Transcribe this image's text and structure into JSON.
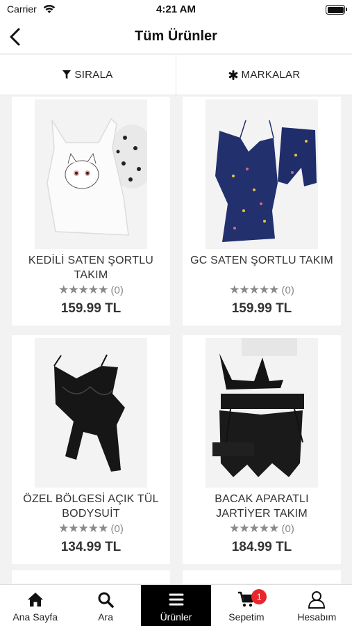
{
  "status": {
    "carrier": "Carrier",
    "time": "4:21 AM"
  },
  "header": {
    "title": "Tüm Ürünler"
  },
  "toolbar": {
    "sort_label": "SIRALA",
    "brands_label": "MARKALAR"
  },
  "products": [
    {
      "name": "KEDİLİ SATEN ŞORTLU TAKIM",
      "rating": 0,
      "reviews": "(0)",
      "price": "159.99 TL"
    },
    {
      "name": "GC SATEN ŞORTLU TAKIM",
      "rating": 0,
      "reviews": "(0)",
      "price": "159.99 TL"
    },
    {
      "name": "ÖZEL BÖLGESİ AÇIK TÜL BODYSUİT",
      "rating": 0,
      "reviews": "(0)",
      "price": "134.99 TL"
    },
    {
      "name": "BACAK APARATLI JARTİYER TAKIM",
      "rating": 0,
      "reviews": "(0)",
      "price": "184.99 TL"
    }
  ],
  "rating_stars": "★★★★★",
  "tabs": [
    {
      "label": "Ana Sayfa",
      "icon": "home-icon"
    },
    {
      "label": "Ara",
      "icon": "search-icon"
    },
    {
      "label": "Ürünler",
      "icon": "menu-icon"
    },
    {
      "label": "Sepetim",
      "icon": "cart-icon"
    },
    {
      "label": "Hesabım",
      "icon": "user-icon"
    }
  ],
  "cart_badge": "1",
  "active_tab": "Ürünler",
  "colors": {
    "accent": "#000000",
    "badge": "#e8262e",
    "navy": "#1f2d6b"
  }
}
